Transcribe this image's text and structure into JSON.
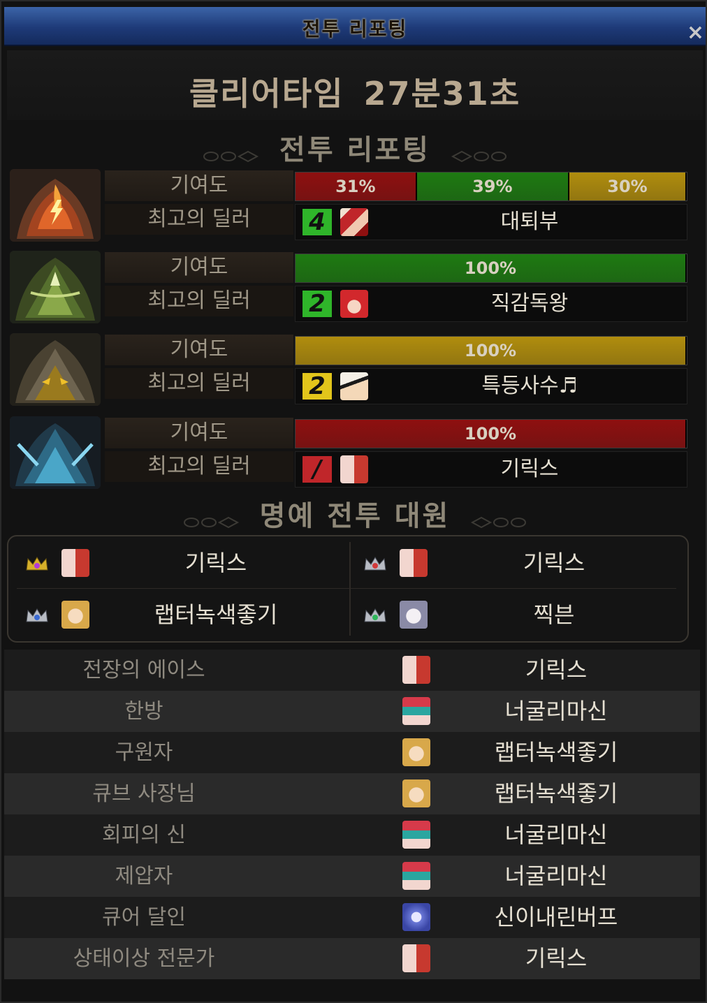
{
  "window": {
    "title": "전투 리포팅",
    "close_label": "×"
  },
  "clear_time": {
    "label": "클리어타임",
    "value": "27분31초"
  },
  "section_report": "전투 리포팅",
  "section_honor": "명예 전투 대원",
  "boss_rows": [
    {
      "icon": "fire-boss-icon",
      "contribution_label": "기여도",
      "contributions": [
        {
          "percent": 31,
          "label": "31%",
          "color": "#8e1010"
        },
        {
          "percent": 39,
          "label": "39%",
          "color": "#1e7a12"
        },
        {
          "percent": 30,
          "label": "30%",
          "color": "#b08d0e"
        }
      ],
      "dealer_label": "최고의 딜러",
      "dealer_rank": "4",
      "dealer_rank_color": "#2fb52a",
      "dealer_name": "대퇴부"
    },
    {
      "icon": "wind-boss-icon",
      "contribution_label": "기여도",
      "contributions": [
        {
          "percent": 100,
          "label": "100%",
          "color": "#1e7a12"
        }
      ],
      "dealer_label": "최고의 딜러",
      "dealer_rank": "2",
      "dealer_rank_color": "#2fb52a",
      "dealer_name": "직감독왕"
    },
    {
      "icon": "earth-boss-icon",
      "contribution_label": "기여도",
      "contributions": [
        {
          "percent": 100,
          "label": "100%",
          "color": "#b08d0e"
        }
      ],
      "dealer_label": "최고의 딜러",
      "dealer_rank": "2",
      "dealer_rank_color": "#e2c51b",
      "dealer_name": "특등사수♬"
    },
    {
      "icon": "water-boss-icon",
      "contribution_label": "기여도",
      "contributions": [
        {
          "percent": 100,
          "label": "100%",
          "color": "#8e1010"
        }
      ],
      "dealer_label": "최고의 딜러",
      "dealer_rank": "/",
      "dealer_rank_color": "#c0262a",
      "dealer_name": "기릭스"
    }
  ],
  "honor_members": [
    {
      "name": "기릭스",
      "crown": "gold-crown-icon",
      "crown_gem": "#b23ad6"
    },
    {
      "name": "기릭스",
      "crown": "silver-crown-icon",
      "crown_gem": "#d23a3a"
    },
    {
      "name": "랩터녹색좋기",
      "crown": "silver-crown-icon",
      "crown_gem": "#3a6ad2"
    },
    {
      "name": "찍븐",
      "crown": "silver-crown-icon",
      "crown_gem": "#2fb55a"
    }
  ],
  "awards": [
    {
      "title": "전장의 에이스",
      "name": "기릭스",
      "avatar": "mosaic-red"
    },
    {
      "title": "한방",
      "name": "너굴리마신",
      "avatar": "mosaic-teal"
    },
    {
      "title": "구원자",
      "name": "랩터녹색좋기",
      "avatar": "mosaic-blonde"
    },
    {
      "title": "큐브 사장님",
      "name": "랩터녹색좋기",
      "avatar": "mosaic-blonde"
    },
    {
      "title": "회피의 신",
      "name": "너굴리마신",
      "avatar": "mosaic-teal"
    },
    {
      "title": "제압자",
      "name": "너굴리마신",
      "avatar": "mosaic-teal"
    },
    {
      "title": "큐어 달인",
      "name": "신이내린버프",
      "avatar": "mosaic-blue"
    },
    {
      "title": "상태이상 전문가",
      "name": "기릭스",
      "avatar": "mosaic-red"
    }
  ]
}
